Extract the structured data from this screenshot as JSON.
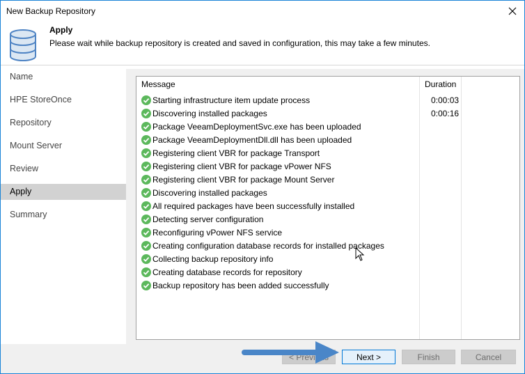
{
  "window": {
    "title": "New Backup Repository"
  },
  "header": {
    "title": "Apply",
    "description": "Please wait while backup repository is created and saved in configuration, this may take a few minutes."
  },
  "sidebar": {
    "steps": [
      {
        "label": "Name",
        "active": false
      },
      {
        "label": "HPE StoreOnce",
        "active": false
      },
      {
        "label": "Repository",
        "active": false
      },
      {
        "label": "Mount Server",
        "active": false
      },
      {
        "label": "Review",
        "active": false
      },
      {
        "label": "Apply",
        "active": true
      },
      {
        "label": "Summary",
        "active": false
      }
    ]
  },
  "grid": {
    "columns": {
      "message": "Message",
      "duration": "Duration"
    },
    "rows": [
      {
        "message": "Starting infrastructure item update process",
        "duration": "0:00:03"
      },
      {
        "message": "Discovering installed packages",
        "duration": "0:00:16"
      },
      {
        "message": "Package VeeamDeploymentSvc.exe has been uploaded",
        "duration": ""
      },
      {
        "message": "Package VeeamDeploymentDll.dll has been uploaded",
        "duration": ""
      },
      {
        "message": "Registering client VBR for package Transport",
        "duration": ""
      },
      {
        "message": "Registering client VBR for package vPower NFS",
        "duration": ""
      },
      {
        "message": "Registering client VBR for package Mount Server",
        "duration": ""
      },
      {
        "message": "Discovering installed packages",
        "duration": ""
      },
      {
        "message": "All required packages have been successfully installed",
        "duration": ""
      },
      {
        "message": "Detecting server configuration",
        "duration": ""
      },
      {
        "message": "Reconfiguring vPower NFS service",
        "duration": ""
      },
      {
        "message": "Creating configuration database records for installed packages",
        "duration": ""
      },
      {
        "message": "Collecting backup repository info",
        "duration": ""
      },
      {
        "message": "Creating database records for repository",
        "duration": ""
      },
      {
        "message": "Backup repository has been added successfully",
        "duration": ""
      }
    ]
  },
  "footer": {
    "previous_label": "< Previous",
    "next_label": "Next >",
    "finish_label": "Finish",
    "cancel_label": "Cancel"
  },
  "icons": {
    "status": "success-check-icon",
    "header": "database-icon",
    "close": "close-icon"
  },
  "colors": {
    "accent": "#0078d7",
    "success": "#5cb85c",
    "arrow": "#4a86c8",
    "selected_step": "#d2d2d2"
  }
}
